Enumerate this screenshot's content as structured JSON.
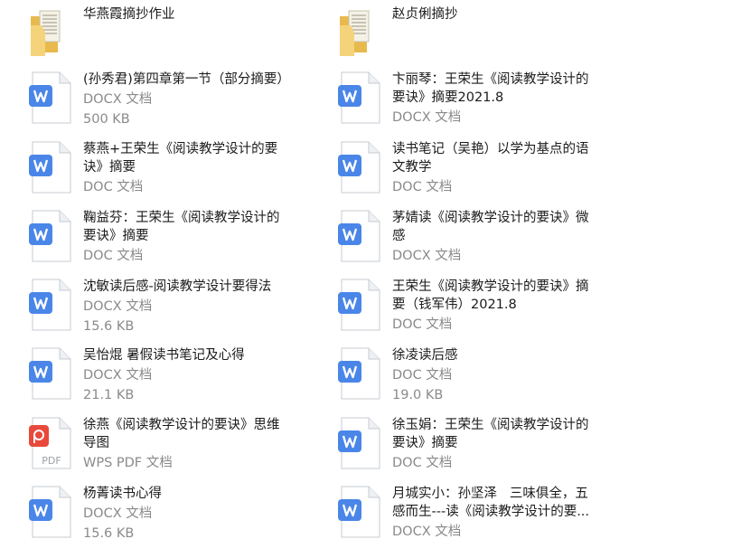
{
  "files": [
    {
      "name": "华燕霞摘抄作业",
      "kind": "folder",
      "type": "",
      "size": ""
    },
    {
      "name": "赵贞俐摘抄",
      "kind": "folder",
      "type": "",
      "size": ""
    },
    {
      "name": "(孙秀君)第四章第一节（部分摘要）",
      "kind": "word",
      "type": "DOCX 文档",
      "size": "500 KB"
    },
    {
      "name": "卞丽琴：王荣生《阅读教学设计的\n要诀》摘要2021.8",
      "kind": "word",
      "type": "DOCX 文档",
      "size": ""
    },
    {
      "name": "蔡燕+王荣生《阅读教学设计的要\n诀》摘要",
      "kind": "word",
      "type": "DOC 文档",
      "size": ""
    },
    {
      "name": "读书笔记（吴艳）以学为基点的语\n文教学",
      "kind": "word",
      "type": "DOC 文档",
      "size": ""
    },
    {
      "name": "鞠益芬：王荣生《阅读教学设计的\n要诀》摘要",
      "kind": "word",
      "type": "DOC 文档",
      "size": ""
    },
    {
      "name": "茅婧读《阅读教学设计的要诀》微\n感",
      "kind": "word",
      "type": "DOCX 文档",
      "size": ""
    },
    {
      "name": "沈敏读后感-阅读教学设计要得法",
      "kind": "word",
      "type": "DOCX 文档",
      "size": "15.6 KB"
    },
    {
      "name": "王荣生《阅读教学设计的要诀》摘\n要（钱军伟）2021.8",
      "kind": "word",
      "type": "DOC 文档",
      "size": ""
    },
    {
      "name": "吴怡焜 暑假读书笔记及心得",
      "kind": "word",
      "type": "DOCX 文档",
      "size": "21.1 KB"
    },
    {
      "name": "徐凌读后感",
      "kind": "word",
      "type": "DOC 文档",
      "size": "19.0 KB"
    },
    {
      "name": "徐燕《阅读教学设计的要诀》思维\n导图",
      "kind": "pdf",
      "type": "WPS PDF 文档",
      "size": ""
    },
    {
      "name": "徐玉娟：王荣生《阅读教学设计的\n要诀》摘要",
      "kind": "word",
      "type": "DOC 文档",
      "size": ""
    },
    {
      "name": "杨菁读书心得",
      "kind": "word",
      "type": "DOCX 文档",
      "size": "15.6 KB"
    },
    {
      "name": "月城实小：孙坚泽   三味俱全，五\n感而生---读《阅读教学设计的要...",
      "kind": "word",
      "type": "DOCX 文档",
      "size": ""
    }
  ],
  "icon_labels": {
    "word": "W",
    "pdf": "PDF"
  },
  "colors": {
    "word_blue": "#4a86e8",
    "pdf_red": "#e9493b",
    "folder_yellow": "#f5d37a",
    "meta_gray": "#8a8a8a"
  }
}
